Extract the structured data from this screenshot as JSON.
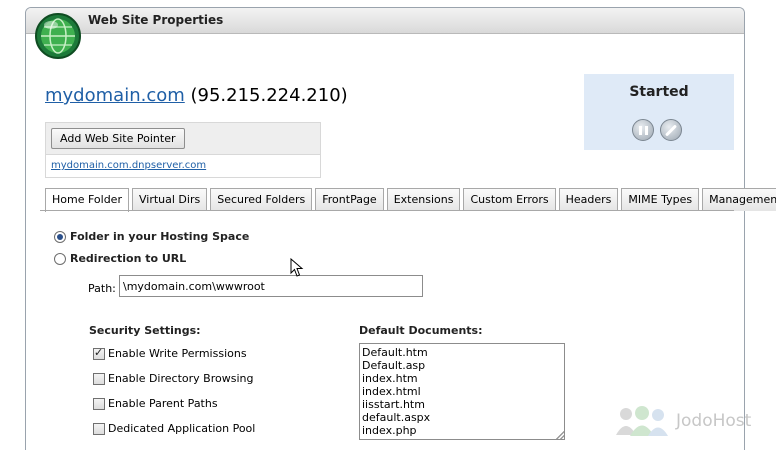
{
  "window": {
    "title": "Web Site Properties"
  },
  "site": {
    "domain": "mydomain.com",
    "ip": "(95.215.224.210)"
  },
  "pointer": {
    "add_button_label": "Add Web Site Pointer",
    "link": "mydomain.com.dnpserver.com"
  },
  "status": {
    "text": "Started",
    "pause_icon": "pause-icon",
    "stop_icon": "stop-icon",
    "box_color": "#dfeaf7"
  },
  "tabs": [
    "Home Folder",
    "Virtual Dirs",
    "Secured Folders",
    "FrontPage",
    "Extensions",
    "Custom Errors",
    "Headers",
    "MIME Types",
    "Management"
  ],
  "active_tab": "Home Folder",
  "home_folder": {
    "option_folder": "Folder in your Hosting Space",
    "option_redirect": "Redirection to URL",
    "selected_option": "Folder in your Hosting Space",
    "path_label": "Path:",
    "path_value": "\\mydomain.com\\wwwroot"
  },
  "security": {
    "heading": "Security Settings:",
    "write": {
      "label": "Enable Write Permissions",
      "checked": true
    },
    "browse": {
      "label": "Enable Directory Browsing",
      "checked": false
    },
    "parent": {
      "label": "Enable Parent Paths",
      "checked": false
    },
    "pool": {
      "label": "Dedicated Application Pool",
      "checked": false
    }
  },
  "default_documents": {
    "heading": "Default Documents:",
    "text": "Default.htm\nDefault.asp\nindex.htm\nindex.html\niisstart.htm\ndefault.aspx\nindex.php"
  },
  "watermark": {
    "text": "JodoHost"
  },
  "colors": {
    "link": "#1f5fa6",
    "header": "#d9d9d9"
  }
}
